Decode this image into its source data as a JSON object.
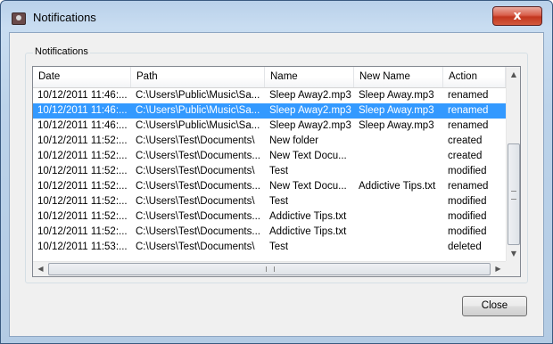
{
  "window": {
    "title": "Notifications",
    "close_glyph": "x"
  },
  "group": {
    "label": "Notifications"
  },
  "columns": [
    "Date",
    "Path",
    "Name",
    "New Name",
    "Action"
  ],
  "rows": [
    {
      "date": "10/12/2011 11:46:...",
      "path": "C:\\Users\\Public\\Music\\Sa...",
      "name": "Sleep Away2.mp3",
      "new_name": "Sleep Away.mp3",
      "action": "renamed",
      "selected": false
    },
    {
      "date": "10/12/2011 11:46:...",
      "path": "C:\\Users\\Public\\Music\\Sa...",
      "name": "Sleep Away2.mp3",
      "new_name": "Sleep Away.mp3",
      "action": "renamed",
      "selected": true
    },
    {
      "date": "10/12/2011 11:46:...",
      "path": "C:\\Users\\Public\\Music\\Sa...",
      "name": "Sleep Away2.mp3",
      "new_name": "Sleep Away.mp3",
      "action": "renamed",
      "selected": false
    },
    {
      "date": "10/12/2011 11:52:...",
      "path": "C:\\Users\\Test\\Documents\\",
      "name": "New folder",
      "new_name": "",
      "action": "created",
      "selected": false
    },
    {
      "date": "10/12/2011 11:52:...",
      "path": "C:\\Users\\Test\\Documents...",
      "name": "New Text Docu...",
      "new_name": "",
      "action": "created",
      "selected": false
    },
    {
      "date": "10/12/2011 11:52:...",
      "path": "C:\\Users\\Test\\Documents\\",
      "name": "Test",
      "new_name": "",
      "action": "modified",
      "selected": false
    },
    {
      "date": "10/12/2011 11:52:...",
      "path": "C:\\Users\\Test\\Documents...",
      "name": "New Text Docu...",
      "new_name": "Addictive Tips.txt",
      "action": "renamed",
      "selected": false
    },
    {
      "date": "10/12/2011 11:52:...",
      "path": "C:\\Users\\Test\\Documents\\",
      "name": "Test",
      "new_name": "",
      "action": "modified",
      "selected": false
    },
    {
      "date": "10/12/2011 11:52:...",
      "path": "C:\\Users\\Test\\Documents...",
      "name": "Addictive Tips.txt",
      "new_name": "",
      "action": "modified",
      "selected": false
    },
    {
      "date": "10/12/2011 11:52:...",
      "path": "C:\\Users\\Test\\Documents...",
      "name": "Addictive Tips.txt",
      "new_name": "",
      "action": "modified",
      "selected": false
    },
    {
      "date": "10/12/2011 11:53:...",
      "path": "C:\\Users\\Test\\Documents\\",
      "name": "Test",
      "new_name": "",
      "action": "deleted",
      "selected": false
    }
  ],
  "buttons": {
    "close": "Close"
  },
  "icons": {
    "app": "notifications-app-icon",
    "window_close": "close-icon",
    "scroll_up": "scroll-up-arrow-icon",
    "scroll_down": "scroll-down-arrow-icon",
    "scroll_left": "scroll-left-arrow-icon",
    "scroll_right": "scroll-right-arrow-icon"
  },
  "colors": {
    "selection": "#3399ff",
    "titlebar": "#b9d1ea"
  }
}
